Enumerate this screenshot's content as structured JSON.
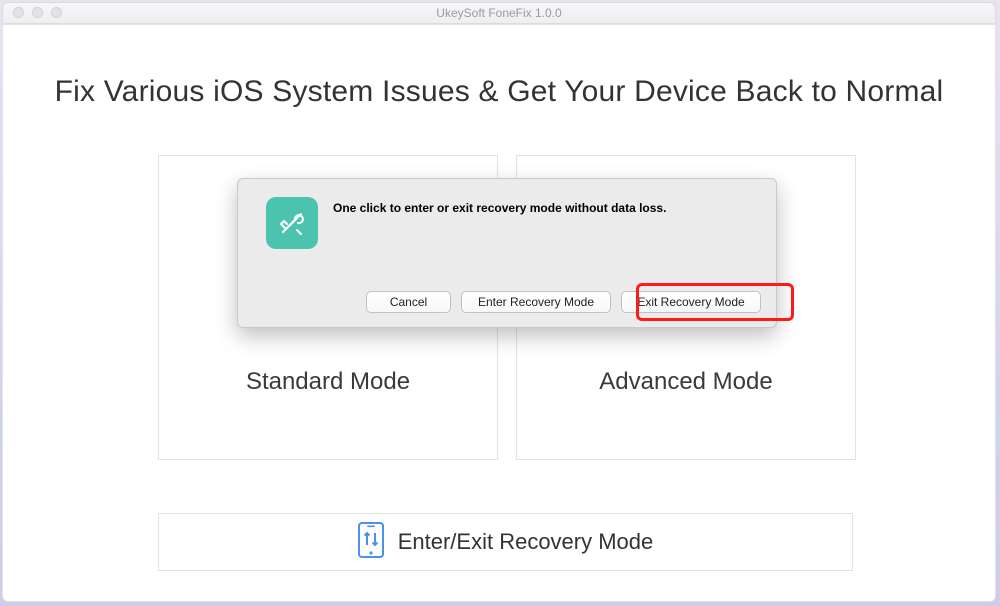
{
  "window": {
    "title": "UkeySoft FoneFix 1.0.0"
  },
  "headline": "Fix Various iOS System Issues & Get Your Device Back to Normal",
  "modes": {
    "standard": "Standard Mode",
    "advanced": "Advanced Mode"
  },
  "recovery_bar": {
    "label": "Enter/Exit Recovery Mode",
    "icon": "phone-sync-icon"
  },
  "dialog": {
    "icon": "tools-icon",
    "message": "One click to enter or exit recovery mode without data loss.",
    "buttons": {
      "cancel": "Cancel",
      "enter": "Enter Recovery Mode",
      "exit": "Exit Recovery Mode"
    }
  },
  "colors": {
    "accent_blue": "#4b8ff1",
    "teal": "#4bc3ae",
    "highlight_red": "#ff1a1a"
  },
  "highlighted_button": "exit"
}
